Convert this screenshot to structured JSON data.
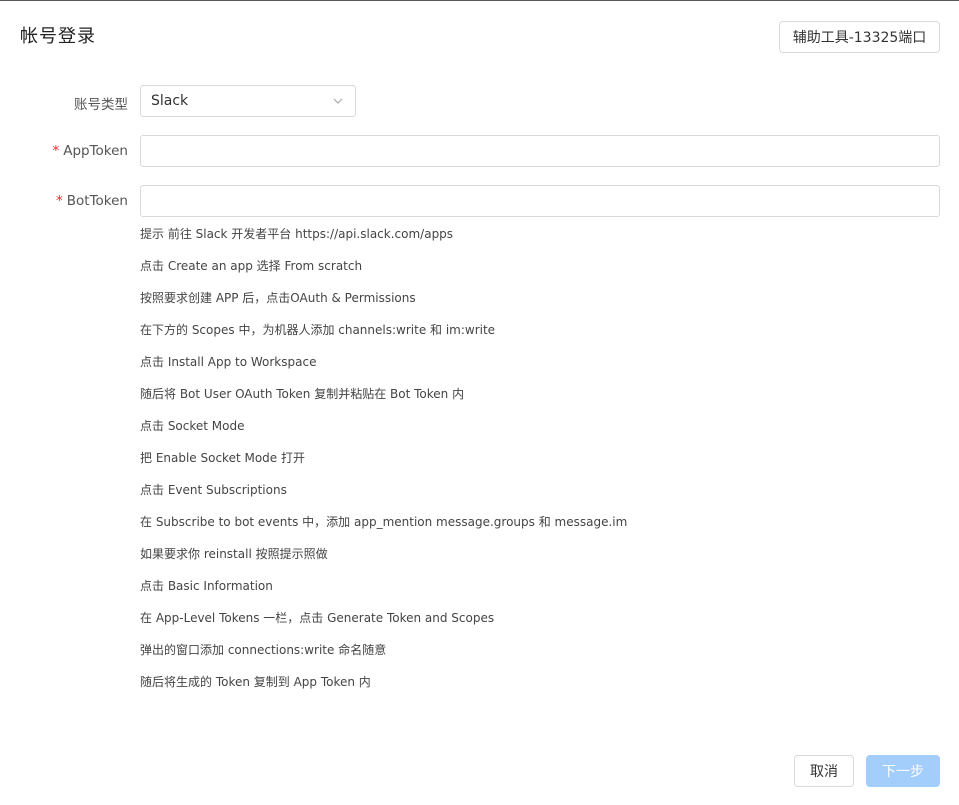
{
  "header": {
    "title": "帐号登录",
    "tool_button_label": "辅助工具-13325端口"
  },
  "form": {
    "account_type": {
      "label": "账号类型",
      "value": "Slack"
    },
    "app_token": {
      "label": "AppToken",
      "required_mark": "*",
      "value": ""
    },
    "bot_token": {
      "label": "BotToken",
      "required_mark": "*",
      "value": ""
    }
  },
  "hints": [
    "提示 前往 Slack 开发者平台 https://api.slack.com/apps",
    "点击 Create an app 选择 From scratch",
    "按照要求创建 APP 后，点击OAuth & Permissions",
    "在下方的 Scopes 中，为机器人添加 channels:write 和 im:write",
    "点击 Install App to Workspace",
    "随后将 Bot User OAuth Token 复制并粘贴在 Bot Token 内",
    "点击 Socket Mode",
    "把 Enable Socket Mode 打开",
    "点击 Event Subscriptions",
    "在 Subscribe to bot events 中，添加 app_mention message.groups 和 message.im",
    "如果要求你 reinstall 按照提示照做",
    "点击 Basic Information",
    "在 App-Level Tokens 一栏，点击 Generate Token and Scopes",
    "弹出的窗口添加 connections:write 命名随意",
    "随后将生成的 Token 复制到 App Token 内"
  ],
  "footer": {
    "cancel_label": "取消",
    "next_label": "下一步"
  },
  "colors": {
    "required": "#f5222d",
    "primary_disabled": "#a3cdfb",
    "border": "#d9d9d9"
  }
}
